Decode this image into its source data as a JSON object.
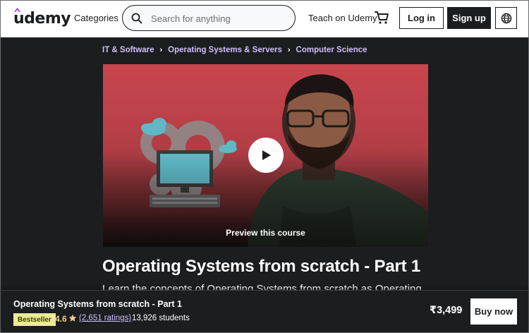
{
  "header": {
    "logo_text": "udemy",
    "categories_label": "Categories",
    "search_placeholder": "Search for anything",
    "teach_label": "Teach on Udemy",
    "login_label": "Log in",
    "signup_label": "Sign up"
  },
  "breadcrumb": [
    "IT & Software",
    "Operating Systems & Servers",
    "Computer Science"
  ],
  "preview": {
    "label": "Preview this course"
  },
  "course": {
    "title": "Operating Systems from scratch - Part 1",
    "description": "Learn the concepts of Operating Systems from scratch as Operating"
  },
  "bottom_bar": {
    "title": "Operating Systems from scratch - Part 1",
    "badge": "Bestseller",
    "rating": "4.6",
    "ratings_count": "(2,651 ratings)",
    "students": "13,926 students",
    "price": "₹3,499",
    "buy_label": "Buy now"
  },
  "colors": {
    "accent_purple": "#a435f0",
    "link_purple": "#cec0fc",
    "rating_orange": "#f3ca8c",
    "badge_yellow": "#eceb98",
    "dark_bg": "#1c1d1f"
  }
}
